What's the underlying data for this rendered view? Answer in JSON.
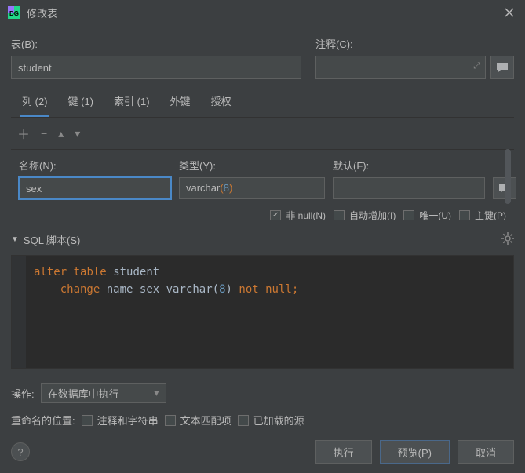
{
  "window": {
    "title": "修改表"
  },
  "labels": {
    "table": "表(B):",
    "comment": "注释(C):",
    "sql_script": "SQL 脚本(S)",
    "action": "操作:",
    "rename_pos": "重命名的位置:"
  },
  "table_name": "student",
  "tabs": [
    {
      "label": "列 (2)",
      "active": true
    },
    {
      "label": "键 (1)",
      "active": false
    },
    {
      "label": "索引 (1)",
      "active": false
    },
    {
      "label": "外键",
      "active": false
    },
    {
      "label": "授权",
      "active": false
    }
  ],
  "column_fields": {
    "name_label": "名称(N):",
    "type_label": "类型(Y):",
    "default_label": "默认(F):",
    "name_value": "sex",
    "type_value": "varchar",
    "type_size": "8",
    "default_value": ""
  },
  "checkboxes": {
    "not_null": "非 null(N)",
    "auto_inc": "自动增加(I)",
    "unique": "唯一(U)",
    "primary": "主键(P)"
  },
  "sql": {
    "line1_kw1": "alter",
    "line1_kw2": "table",
    "line1_ident": "student",
    "line2_kw1": "change",
    "line2_id1": "name",
    "line2_id2": "sex",
    "line2_type": "varchar",
    "line2_size": "8",
    "line2_kw2": "not",
    "line2_kw3": "null",
    "line2_semi": ";"
  },
  "action_select": "在数据库中执行",
  "rename_checks": {
    "comments": "注释和字符串",
    "text_occ": "文本匹配项",
    "loaded_src": "已加载的源"
  },
  "buttons": {
    "execute": "执行",
    "preview": "预览(P)",
    "cancel": "取消"
  }
}
